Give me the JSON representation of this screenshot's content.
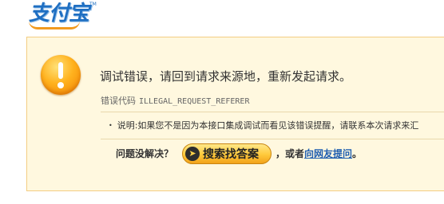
{
  "logo": {
    "text": "支付宝",
    "tm": "TM"
  },
  "error": {
    "headline": "调试错误，请回到请求来源地，重新发起请求。",
    "code_label": "错误代码",
    "code": "ILLEGAL_REQUEST_REFERER",
    "note_bullet": "•",
    "note": "说明:如果您不是因为本接口集成调试而看见该错误提醒，请联系本次请求来汇"
  },
  "help": {
    "prompt": "问题没解决？",
    "search_icon": "arrow-right-icon",
    "search_label": "搜索找答案",
    "or_text": "，或者",
    "ask_link": "向网友提问",
    "end": "。"
  },
  "colors": {
    "panel_bg": "#fff8df",
    "panel_border": "#f3cd83",
    "logo_blue": "#1f6fc2",
    "link_blue": "#1f5fb0",
    "button_yellow": "#ffc93b"
  }
}
